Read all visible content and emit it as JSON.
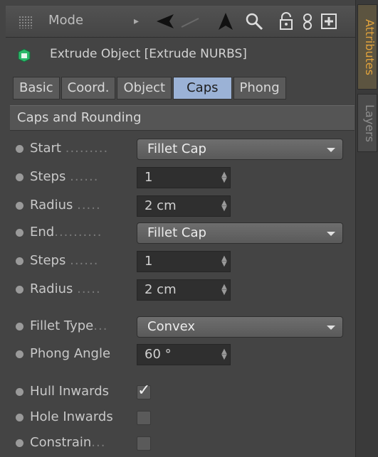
{
  "toolbar": {
    "mode_label": "Mode",
    "icons": [
      "grip-icon",
      "back-arrow-icon",
      "forward-arrow-icon",
      "up-arrow-icon",
      "search-icon",
      "lock-icon",
      "link-icon",
      "new-window-icon"
    ]
  },
  "header": {
    "title": "Extrude Object [Extrude NURBS]"
  },
  "tabs": [
    {
      "label": "Basic",
      "active": false
    },
    {
      "label": "Coord.",
      "active": false
    },
    {
      "label": "Object",
      "active": false
    },
    {
      "label": "Caps",
      "active": true
    },
    {
      "label": "Phong",
      "active": false
    }
  ],
  "section": {
    "title": "Caps and Rounding"
  },
  "rows": {
    "start": {
      "label": "Start",
      "leader": ".........",
      "value": "Fillet Cap"
    },
    "steps1": {
      "label": "Steps",
      "leader": "......",
      "value": "1"
    },
    "radius1": {
      "label": "Radius",
      "leader": ".....",
      "value": "2 cm"
    },
    "end": {
      "label": "End",
      "leader": "..........",
      "value": "Fillet Cap"
    },
    "steps2": {
      "label": "Steps",
      "leader": "......",
      "value": "1"
    },
    "radius2": {
      "label": "Radius",
      "leader": ".....",
      "value": "2 cm"
    },
    "fillet_type": {
      "label": "Fillet Type",
      "leader": "...",
      "value": "Convex"
    },
    "phong_angle": {
      "label": "Phong Angle",
      "value": "60 °"
    },
    "hull_inwards": {
      "label": "Hull Inwards",
      "checked": true
    },
    "hole_inwards": {
      "label": "Hole Inwards",
      "checked": false
    },
    "constrain": {
      "label": "Constrain",
      "leader": "...",
      "checked": false
    }
  },
  "side_tabs": {
    "attributes": "Attributes",
    "layers": "Layers"
  },
  "colors": {
    "accent": "#e0a23c",
    "active_tab": "#9bb2d6"
  }
}
